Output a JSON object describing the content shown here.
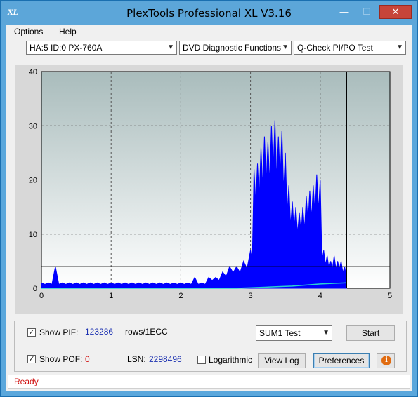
{
  "window": {
    "title": "PlexTools Professional XL V3.16",
    "icon_label": "XL",
    "buttons": {
      "minimize": "—",
      "maximize": "☐",
      "close": "✕"
    }
  },
  "menu": {
    "items": [
      {
        "label": "Options"
      },
      {
        "label": "Help"
      }
    ]
  },
  "toolbar": {
    "drive_select": "HA:5 ID:0  PX-760A",
    "function_select": "DVD Diagnostic Functions",
    "test_select": "Q-Check PI/PO Test"
  },
  "chart_data": {
    "type": "area",
    "xlim": [
      0,
      5
    ],
    "ylim": [
      0,
      40
    ],
    "x_ticks": [
      "0",
      "1",
      "2",
      "3",
      "4",
      "5"
    ],
    "y_ticks": [
      "0",
      "10",
      "20",
      "30",
      "40"
    ],
    "grid": true,
    "threshold_line": 4,
    "end_marker_x": 4.38,
    "colors": {
      "background_top": "#a9bcbc",
      "background_bottom": "#ffffff",
      "series": "#0000ff",
      "sum_line": "#2ad0d0"
    },
    "series": [
      {
        "x": [
          0.0,
          0.1,
          0.2,
          0.3,
          0.4,
          0.5,
          0.6,
          0.7,
          0.8,
          0.9,
          1.0,
          1.1,
          1.2,
          1.3,
          1.4,
          1.5,
          1.6,
          1.7,
          1.8,
          1.9,
          2.0,
          2.1,
          2.2,
          2.3,
          2.4,
          2.5,
          2.6,
          2.7,
          2.8,
          2.9,
          3.0,
          3.05,
          3.1,
          3.15,
          3.2,
          3.25,
          3.3,
          3.35,
          3.4,
          3.45,
          3.5,
          3.55,
          3.6,
          3.65,
          3.7,
          3.75,
          3.8,
          3.85,
          3.9,
          3.95,
          4.0,
          4.05,
          4.1,
          4.15,
          4.2,
          4.25,
          4.3,
          4.35,
          4.38
        ],
        "values": [
          1,
          1,
          4,
          1,
          1,
          1,
          1,
          1,
          1,
          1,
          1,
          1,
          1,
          1,
          1,
          1,
          1,
          1,
          1,
          1,
          1,
          1,
          2,
          1,
          2,
          2,
          3,
          4,
          4,
          5,
          7,
          22,
          23,
          26,
          28,
          27,
          30,
          31,
          28,
          29,
          25,
          19,
          16,
          15,
          14,
          15,
          17,
          18,
          19,
          21,
          20,
          7,
          6,
          5,
          6,
          5,
          5,
          4,
          4
        ]
      },
      {
        "x": [
          0,
          2.8,
          3.0,
          3.2,
          3.4,
          3.6,
          3.8,
          4.0,
          4.2,
          4.38
        ],
        "values": [
          0,
          0,
          0.1,
          0.2,
          0.3,
          0.4,
          0.6,
          0.8,
          0.9,
          1.0
        ]
      }
    ]
  },
  "controls": {
    "show_pif_label": "Show PIF:",
    "pif_value": "123286",
    "pif_unit": "rows/1ECC",
    "show_pof_label": "Show POF:",
    "pof_value": "0",
    "lsn_label": "LSN:",
    "lsn_value": "2298496",
    "logarithmic_label": "Logarithmic",
    "test_mode_select": "SUM1 Test",
    "start_button": "Start",
    "view_log_button": "View Log",
    "preferences_button": "Preferences",
    "info_button": "i",
    "checkbox_mark": "✓"
  },
  "status": {
    "text": "Ready"
  }
}
